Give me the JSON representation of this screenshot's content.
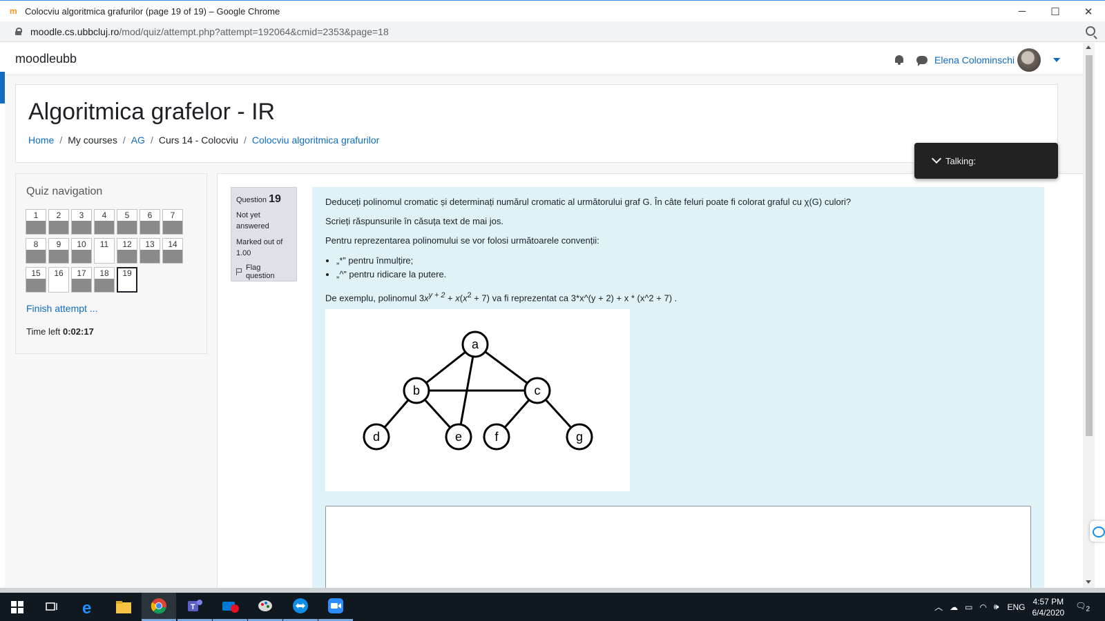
{
  "window": {
    "title": "Colocviu algoritmica grafurilor (page 19 of 19) – Google Chrome",
    "favicon": "m",
    "controls": {
      "minimize": "─",
      "maximize": "☐",
      "close": "✕"
    }
  },
  "address": {
    "host": "moodle.cs.ubbcluj.ro",
    "path": "/mod/quiz/attempt.php?attempt=192064&cmid=2353&page=18"
  },
  "navbar": {
    "brand": "moodleubb",
    "user": "Elena Colominschi"
  },
  "header": {
    "course_title": "Algoritmica grafelor - IR",
    "breadcrumb": [
      {
        "label": "Home"
      },
      {
        "label": "My courses"
      },
      {
        "label": "AG"
      },
      {
        "label": "Curs 14 - Colocviu"
      },
      {
        "label": "Colocviu algoritmica grafurilor"
      }
    ],
    "separator": "/"
  },
  "talking": {
    "label": "Talking:"
  },
  "quiz_nav": {
    "title": "Quiz navigation",
    "buttons": [
      {
        "label": "1",
        "answered": true
      },
      {
        "label": "2",
        "answered": true
      },
      {
        "label": "3",
        "answered": true
      },
      {
        "label": "4",
        "answered": true
      },
      {
        "label": "5",
        "answered": true
      },
      {
        "label": "6",
        "answered": true
      },
      {
        "label": "7",
        "answered": true
      },
      {
        "label": "8",
        "answered": true
      },
      {
        "label": "9",
        "answered": true
      },
      {
        "label": "10",
        "answered": true
      },
      {
        "label": "11",
        "answered": false
      },
      {
        "label": "12",
        "answered": true
      },
      {
        "label": "13",
        "answered": true
      },
      {
        "label": "14",
        "answered": true
      },
      {
        "label": "15",
        "answered": true
      },
      {
        "label": "16",
        "answered": false
      },
      {
        "label": "17",
        "answered": true
      },
      {
        "label": "18",
        "answered": true
      },
      {
        "label": "19",
        "answered": false,
        "current": true
      }
    ],
    "finish": "Finish attempt ...",
    "time_label": "Time left",
    "time_value": "0:02:17"
  },
  "question": {
    "qno_label": "Question",
    "qno": "19",
    "state": "Not yet answered",
    "grade": "Marked out of 1.00",
    "flag": "Flag question",
    "text1": "Deduceți polinomul cromatic și determinați numărul cromatic al următorului graf G. În câte feluri poate fi colorat graful cu χ(G) culori?",
    "text2": "Scrieți răspunsurile în căsuța text de mai jos.",
    "text3": "Pentru reprezentarea polinomului se vor folosi următoarele convenții:",
    "bullets": [
      "„*” pentru înmulțire;",
      "„^” pentru ridicare la putere."
    ],
    "example": {
      "prefix": "De exemplu, polinomul",
      "c1": "3",
      "x1": "x",
      "sup1": "y + 2",
      "plus1": "+",
      "x2": "x",
      "open": "(",
      "x3": "x",
      "sup2": "2",
      "tail": "+ 7)",
      "mid": "va fi reprezentat ca",
      "code": "3*x^(y + 2) + x * (x^2 + 7)",
      "end": "."
    },
    "answer_value": ""
  },
  "graph": {
    "nodes": [
      {
        "id": "a",
        "label": "a"
      },
      {
        "id": "b",
        "label": "b"
      },
      {
        "id": "c",
        "label": "c"
      },
      {
        "id": "d",
        "label": "d"
      },
      {
        "id": "e",
        "label": "e"
      },
      {
        "id": "f",
        "label": "f"
      },
      {
        "id": "g",
        "label": "g"
      }
    ],
    "edges": [
      [
        "a",
        "b"
      ],
      [
        "a",
        "c"
      ],
      [
        "a",
        "e"
      ],
      [
        "b",
        "c"
      ],
      [
        "b",
        "d"
      ],
      [
        "b",
        "e"
      ],
      [
        "c",
        "f"
      ],
      [
        "c",
        "g"
      ]
    ]
  },
  "taskbar": {
    "apps": [
      "windows-start",
      "task-view",
      "edge",
      "file-explorer",
      "chrome",
      "teams",
      "mail",
      "paint",
      "teamviewer",
      "zoom"
    ],
    "lang": "ENG",
    "time": "4:57 PM",
    "date": "6/4/2020",
    "notifications": "2"
  },
  "colors": {
    "link": "#0f6cbf",
    "question_bg": "#def2f8",
    "answered_fill": "#8a8a8a"
  }
}
